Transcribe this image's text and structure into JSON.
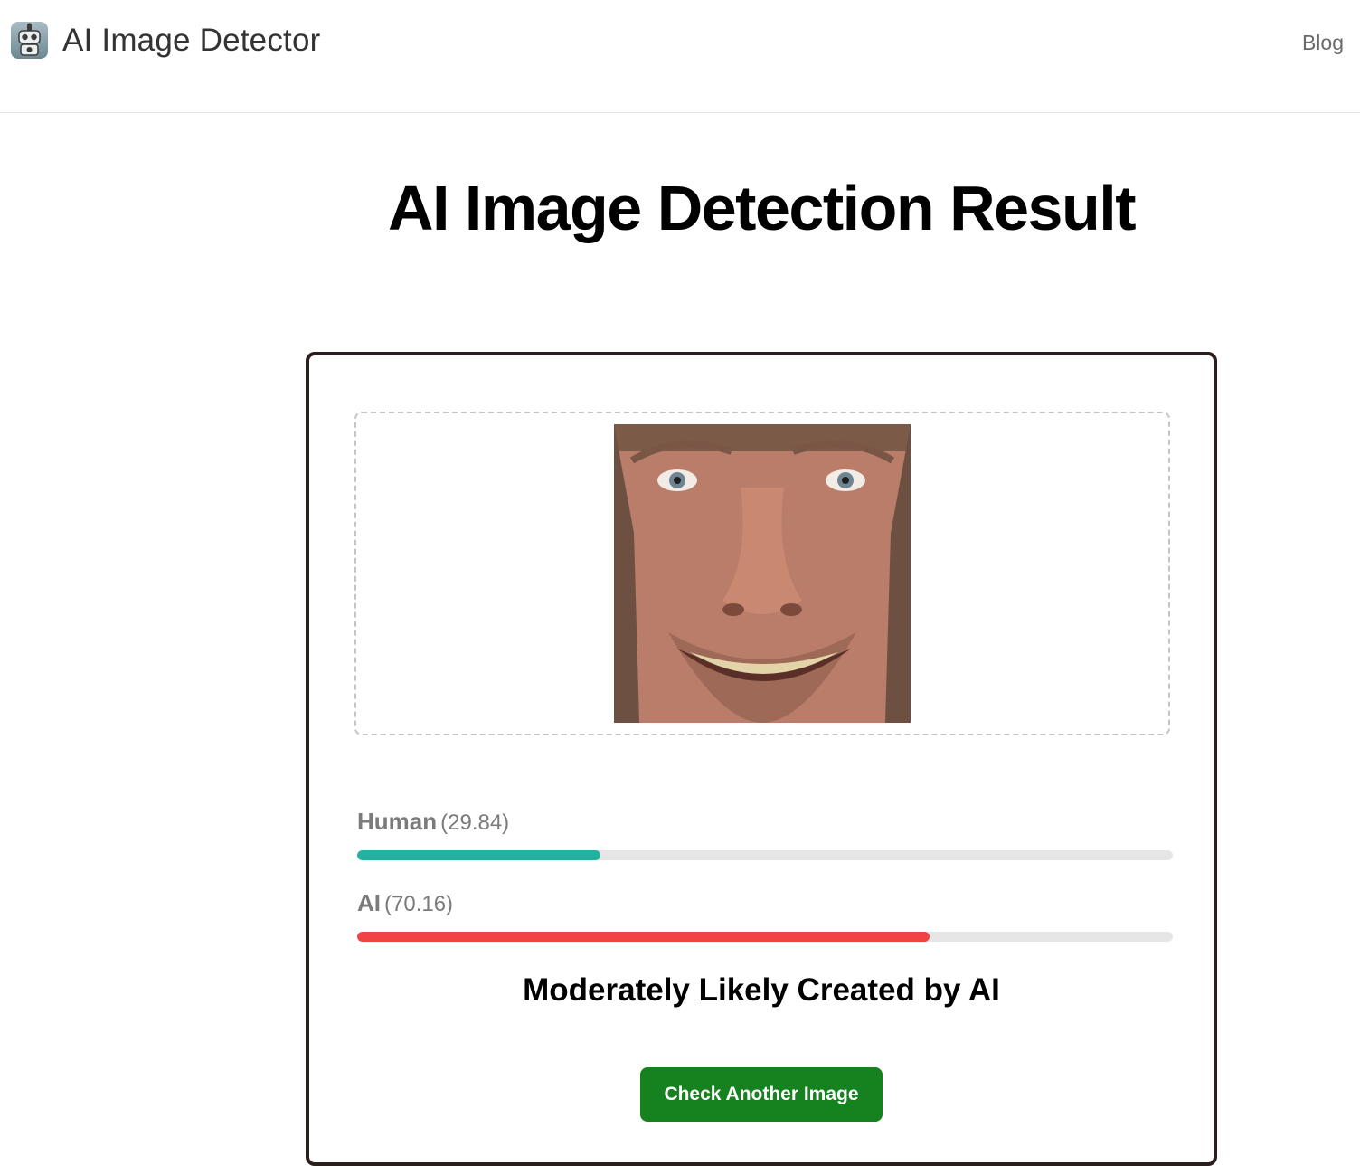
{
  "header": {
    "brand_name": "AI Image Detector",
    "logo_icon": "robot-icon",
    "nav": {
      "blog_label": "Blog"
    }
  },
  "main": {
    "title": "AI Image Detection Result",
    "image": {
      "subject": "uploaded-face-photo"
    },
    "scores": {
      "human": {
        "label": "Human",
        "value_text": "(29.84)",
        "value": 29.84,
        "color": "#22b3a0"
      },
      "ai": {
        "label": "AI",
        "value_text": "(70.16)",
        "value": 70.16,
        "color": "#ef4444"
      }
    },
    "verdict": "Moderately Likely Created by AI",
    "check_button_label": "Check Another Image"
  },
  "colors": {
    "button_green": "#16811f",
    "track_gray": "#e6e6e6",
    "card_border": "#2a1f1c"
  }
}
